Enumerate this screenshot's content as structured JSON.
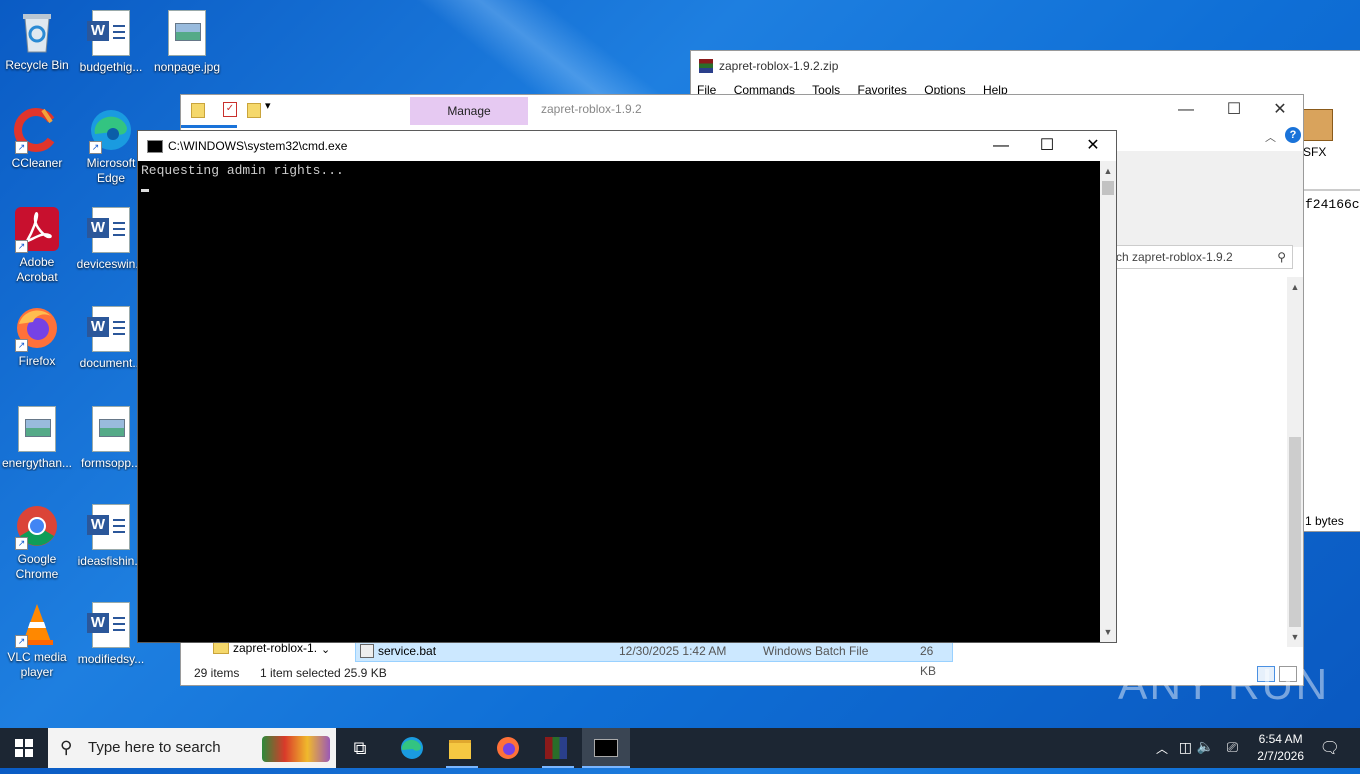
{
  "desktop": {
    "icons": [
      {
        "label": "Recycle Bin"
      },
      {
        "label": "budgethig..."
      },
      {
        "label": "nonpage.jpg"
      },
      {
        "label": "CCleaner"
      },
      {
        "label": "Microsoft Edge"
      },
      {
        "label": "Adobe Acrobat"
      },
      {
        "label": "deviceswin..."
      },
      {
        "label": "Firefox"
      },
      {
        "label": "document..."
      },
      {
        "label": "energythan..."
      },
      {
        "label": "formsopp..."
      },
      {
        "label": "Google Chrome"
      },
      {
        "label": "ideasfishin..."
      },
      {
        "label": "VLC media player"
      },
      {
        "label": "modifiedsy..."
      }
    ]
  },
  "winrar": {
    "title": "zapret-roblox-1.9.2.zip",
    "menu": [
      "File",
      "Commands",
      "Tools",
      "Favorites",
      "Options",
      "Help"
    ],
    "sfx_label": "SFX",
    "hash_fragment": "f24166c",
    "size_fragment": "1 bytes"
  },
  "explorer": {
    "manage_tab": "Manage",
    "title": "zapret-roblox-1.9.2",
    "search_placeholder": "rch zapret-roblox-1.9.2",
    "nav_folder": "zapret-roblox-1.",
    "selected_file": {
      "name": "service.bat",
      "date": "12/30/2025 1:42 AM",
      "type": "Windows Batch File",
      "size": "26 KB"
    },
    "status": {
      "items": "29 items",
      "selected": "1 item selected",
      "size": "25.9 KB"
    }
  },
  "cmd": {
    "title": "C:\\WINDOWS\\system32\\cmd.exe",
    "output": "Requesting admin rights..."
  },
  "watermark": "ANY RUN",
  "taskbar": {
    "search_placeholder": "Type here to search",
    "time": "6:54 AM",
    "date": "2/7/2026"
  }
}
